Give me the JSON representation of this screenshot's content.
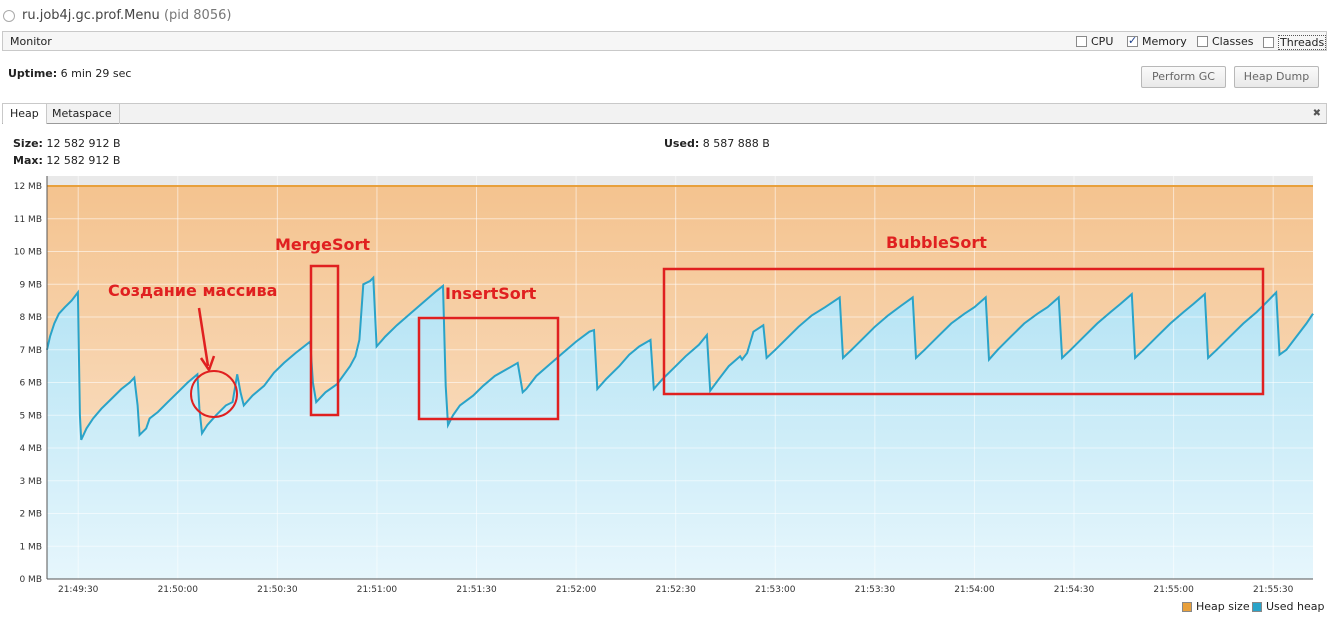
{
  "window": {
    "title": "ru.job4j.gc.prof.Menu",
    "pid": "(pid 8056)"
  },
  "monitor": {
    "label": "Monitor",
    "checkboxes": [
      {
        "label": "CPU",
        "checked": false
      },
      {
        "label": "Memory",
        "checked": true
      },
      {
        "label": "Classes",
        "checked": false
      },
      {
        "label": "Threads",
        "checked": false
      }
    ]
  },
  "uptime": {
    "label": "Uptime:",
    "value": "6 min 29 sec"
  },
  "buttons": {
    "perform_gc": "Perform GC",
    "heap_dump": "Heap Dump"
  },
  "tabs": [
    {
      "label": "Heap",
      "active": true
    },
    {
      "label": "Metaspace",
      "active": false
    }
  ],
  "stats": {
    "size_label": "Size:",
    "size_value": "12 582 912 B",
    "max_label": "Max:",
    "max_value": "12 582 912 B",
    "used_label": "Used:",
    "used_value": "8 587 888 B"
  },
  "chart_data": {
    "type": "area",
    "ylim": [
      0,
      12
    ],
    "yticks": [
      "0 MB",
      "1 MB",
      "2 MB",
      "3 MB",
      "4 MB",
      "5 MB",
      "6 MB",
      "7 MB",
      "8 MB",
      "9 MB",
      "10 MB",
      "11 MB",
      "12 MB"
    ],
    "xticks": [
      "21:49:30",
      "21:50:00",
      "21:50:30",
      "21:51:00",
      "21:51:30",
      "21:52:00",
      "21:52:30",
      "21:53:00",
      "21:53:30",
      "21:54:00",
      "21:54:30",
      "21:55:00",
      "21:55:30"
    ],
    "x_range_seconds_after_21_49_00": [
      20.6,
      402
    ],
    "grid": true,
    "legend_position": "bottom-right",
    "colors": {
      "heap_size": "#e8a03c",
      "used_heap": "#2aa3c8",
      "heap_fill": "#f6c99a",
      "used_fill": "#b9e6f5"
    },
    "series": [
      {
        "name": "Heap size",
        "values_constant_mb": 12
      },
      {
        "name": "Used heap",
        "points_seconds_mb": [
          [
            20.6,
            7.0
          ],
          [
            21.5,
            7.4
          ],
          [
            22.8,
            7.8
          ],
          [
            24.2,
            8.1
          ],
          [
            26.0,
            8.3
          ],
          [
            28.0,
            8.5
          ],
          [
            29.9,
            8.75
          ],
          [
            30.5,
            5.0
          ],
          [
            30.9,
            4.25
          ],
          [
            32.5,
            4.6
          ],
          [
            34.5,
            4.9
          ],
          [
            37.0,
            5.2
          ],
          [
            40.0,
            5.5
          ],
          [
            43.0,
            5.8
          ],
          [
            45.5,
            6.0
          ],
          [
            46.9,
            6.15
          ],
          [
            47.9,
            5.3
          ],
          [
            48.5,
            4.4
          ],
          [
            50.5,
            4.6
          ],
          [
            51.5,
            4.9
          ],
          [
            54.0,
            5.1
          ],
          [
            57.0,
            5.4
          ],
          [
            60.0,
            5.7
          ],
          [
            63.0,
            6.0
          ],
          [
            65.9,
            6.25
          ],
          [
            66.5,
            5.2
          ],
          [
            67.3,
            4.45
          ],
          [
            68.9,
            4.7
          ],
          [
            71.5,
            5.0
          ],
          [
            74.5,
            5.3
          ],
          [
            76.5,
            5.4
          ],
          [
            77.9,
            6.25
          ],
          [
            78.9,
            5.7
          ],
          [
            79.9,
            5.3
          ],
          [
            82.5,
            5.6
          ],
          [
            86.0,
            5.9
          ],
          [
            89.0,
            6.3
          ],
          [
            92.0,
            6.6
          ],
          [
            95.5,
            6.9
          ],
          [
            99.9,
            7.25
          ],
          [
            100.7,
            6.0
          ],
          [
            101.7,
            5.4
          ],
          [
            104.5,
            5.7
          ],
          [
            108.0,
            5.95
          ],
          [
            111.9,
            6.5
          ],
          [
            113.5,
            6.8
          ],
          [
            114.7,
            7.3
          ],
          [
            115.9,
            9.0
          ],
          [
            117.9,
            9.1
          ],
          [
            118.9,
            9.2
          ],
          [
            119.9,
            7.1
          ],
          [
            122.5,
            7.4
          ],
          [
            126.0,
            7.75
          ],
          [
            130.0,
            8.1
          ],
          [
            134.0,
            8.45
          ],
          [
            138.0,
            8.8
          ],
          [
            139.9,
            8.95
          ],
          [
            140.7,
            5.9
          ],
          [
            141.4,
            4.7
          ],
          [
            142.9,
            5.0
          ],
          [
            145.0,
            5.3
          ],
          [
            149.0,
            5.6
          ],
          [
            152.0,
            5.9
          ],
          [
            155.5,
            6.2
          ],
          [
            159.0,
            6.4
          ],
          [
            162.4,
            6.6
          ],
          [
            163.9,
            5.7
          ],
          [
            165.0,
            5.8
          ],
          [
            168.0,
            6.2
          ],
          [
            172.0,
            6.55
          ],
          [
            176.0,
            6.9
          ],
          [
            180.0,
            7.25
          ],
          [
            184.0,
            7.55
          ],
          [
            185.4,
            7.6
          ],
          [
            186.4,
            5.8
          ],
          [
            189.0,
            6.1
          ],
          [
            193.0,
            6.5
          ],
          [
            196.0,
            6.85
          ],
          [
            199.0,
            7.1
          ],
          [
            202.4,
            7.3
          ],
          [
            203.4,
            5.8
          ],
          [
            206.0,
            6.1
          ],
          [
            209.5,
            6.45
          ],
          [
            213.0,
            6.8
          ],
          [
            217.0,
            7.15
          ],
          [
            219.4,
            7.45
          ],
          [
            220.4,
            5.75
          ],
          [
            223.0,
            6.1
          ],
          [
            226.0,
            6.5
          ],
          [
            229.4,
            6.8
          ],
          [
            230.0,
            6.7
          ],
          [
            231.5,
            6.9
          ],
          [
            233.4,
            7.55
          ],
          [
            236.4,
            7.75
          ],
          [
            237.4,
            6.75
          ],
          [
            240.0,
            7.0
          ],
          [
            243.5,
            7.35
          ],
          [
            247.0,
            7.7
          ],
          [
            251.0,
            8.05
          ],
          [
            255.0,
            8.3
          ],
          [
            259.4,
            8.6
          ],
          [
            260.4,
            6.75
          ],
          [
            263.0,
            7.0
          ],
          [
            266.5,
            7.35
          ],
          [
            270.0,
            7.7
          ],
          [
            274.0,
            8.05
          ],
          [
            278.0,
            8.35
          ],
          [
            281.4,
            8.6
          ],
          [
            282.4,
            6.75
          ],
          [
            285.0,
            7.0
          ],
          [
            289.0,
            7.4
          ],
          [
            293.0,
            7.8
          ],
          [
            297.0,
            8.1
          ],
          [
            300.0,
            8.3
          ],
          [
            303.4,
            8.6
          ],
          [
            304.4,
            6.7
          ],
          [
            307.0,
            7.0
          ],
          [
            311.0,
            7.4
          ],
          [
            315.0,
            7.8
          ],
          [
            319.0,
            8.1
          ],
          [
            322.0,
            8.3
          ],
          [
            325.4,
            8.6
          ],
          [
            326.4,
            6.75
          ],
          [
            329.0,
            7.0
          ],
          [
            333.0,
            7.4
          ],
          [
            337.0,
            7.8
          ],
          [
            341.0,
            8.15
          ],
          [
            344.0,
            8.4
          ],
          [
            347.4,
            8.7
          ],
          [
            348.4,
            6.75
          ],
          [
            351.0,
            7.0
          ],
          [
            355.0,
            7.4
          ],
          [
            359.0,
            7.8
          ],
          [
            363.0,
            8.15
          ],
          [
            366.0,
            8.4
          ],
          [
            369.4,
            8.7
          ],
          [
            370.4,
            6.75
          ],
          [
            373.0,
            7.0
          ],
          [
            377.0,
            7.4
          ],
          [
            381.0,
            7.8
          ],
          [
            385.0,
            8.15
          ],
          [
            388.0,
            8.45
          ],
          [
            390.9,
            8.75
          ],
          [
            391.9,
            6.85
          ],
          [
            394.0,
            7.0
          ],
          [
            397.0,
            7.4
          ],
          [
            400.0,
            7.8
          ],
          [
            402.0,
            8.1
          ]
        ]
      }
    ],
    "annotations": [
      {
        "text": "Создание массива",
        "color": "#e02020"
      },
      {
        "text": "MergeSort",
        "color": "#e02020"
      },
      {
        "text": "InsertSort",
        "color": "#e02020"
      },
      {
        "text": "BubbleSort",
        "color": "#e02020"
      }
    ]
  },
  "legend": {
    "heap_size": "Heap size",
    "used_heap": "Used heap"
  }
}
